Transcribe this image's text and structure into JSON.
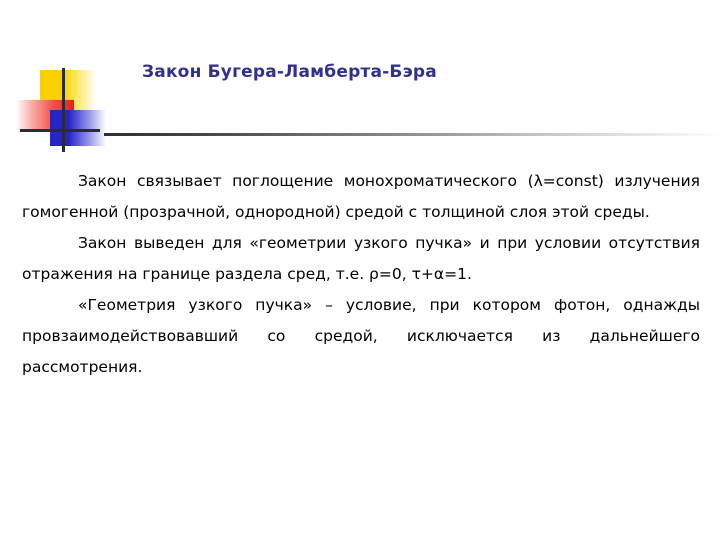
{
  "slide": {
    "title": "Закон Бугера-Ламберта-Бэра",
    "title_color": "#31318C",
    "background_color": "#FFFFFF",
    "divider_color_start": "#2E2E2E",
    "divider_color_end": "#FFFFFF",
    "logo": {
      "yellow_color": "#FFD000",
      "red_color": "#ED1B16",
      "blue_color": "#2626C8",
      "line_color": "#2B2B33"
    },
    "paragraphs": [
      "Закон связывает поглощение монохроматического (λ=const) излучения гомогенной (прозрачной, однородной) средой с толщиной слоя этой среды.",
      "Закон выведен для «геометрии узкого пучка» и при условии отсутствия отражения на границе раздела сред, т.е. ρ=0, τ+α=1.",
      "«Геометрия узкого пучка» – условие, при котором фотон, однажды провзаимодействовавший со средой, исключается из дальнейшего рассмотрения."
    ]
  }
}
